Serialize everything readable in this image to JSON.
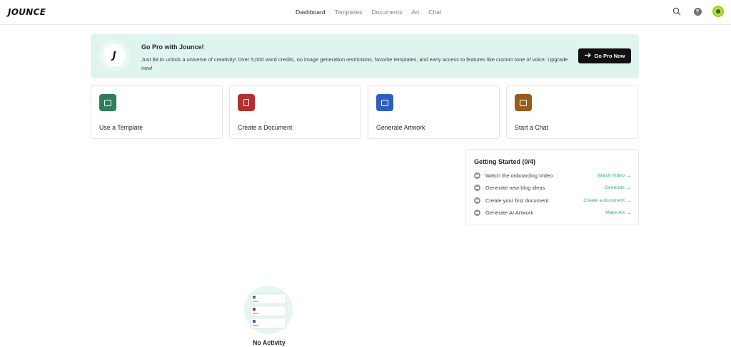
{
  "app": {
    "logo": "JOUNCE"
  },
  "nav": {
    "items": [
      {
        "label": "Dashboard",
        "active": true
      },
      {
        "label": "Templates",
        "active": false
      },
      {
        "label": "Documents",
        "active": false
      },
      {
        "label": "Art",
        "active": false
      },
      {
        "label": "Chat",
        "active": false
      }
    ]
  },
  "header_icons": [
    "search-icon",
    "help-icon",
    "avatar"
  ],
  "promo": {
    "badge": "J",
    "title": "Go Pro with Jounce!",
    "text": "Just $9 to unlock a universe of creativity! Over 5,000 word credits, no image generation restrictions, favorite templates, and early access to features like custom tone of voice. Upgrade now!",
    "button_label": "Go Pro Now"
  },
  "cards": [
    {
      "label": "Use a Template",
      "color": "#2e7d5b"
    },
    {
      "label": "Create a Document",
      "color": "#b3302f"
    },
    {
      "label": "Generate Artwork",
      "color": "#2f5fbf"
    },
    {
      "label": "Start a Chat",
      "color": "#9a5a1c"
    }
  ],
  "getting_started": {
    "title": "Getting Started (0/4)",
    "tasks": [
      {
        "text": "Watch the onboarding Video",
        "link": "Watch Video"
      },
      {
        "text": "Generate new blog ideas",
        "link": "Generate"
      },
      {
        "text": "Create your first document",
        "link": "Create a document"
      },
      {
        "text": "Generate AI Artwork",
        "link": "Make Art"
      }
    ]
  },
  "activity": {
    "empty_label": "No Activity"
  },
  "colors": {
    "accent": "#2bb07f",
    "banner_bg": "#dff4ee",
    "button_dark": "#111111"
  }
}
